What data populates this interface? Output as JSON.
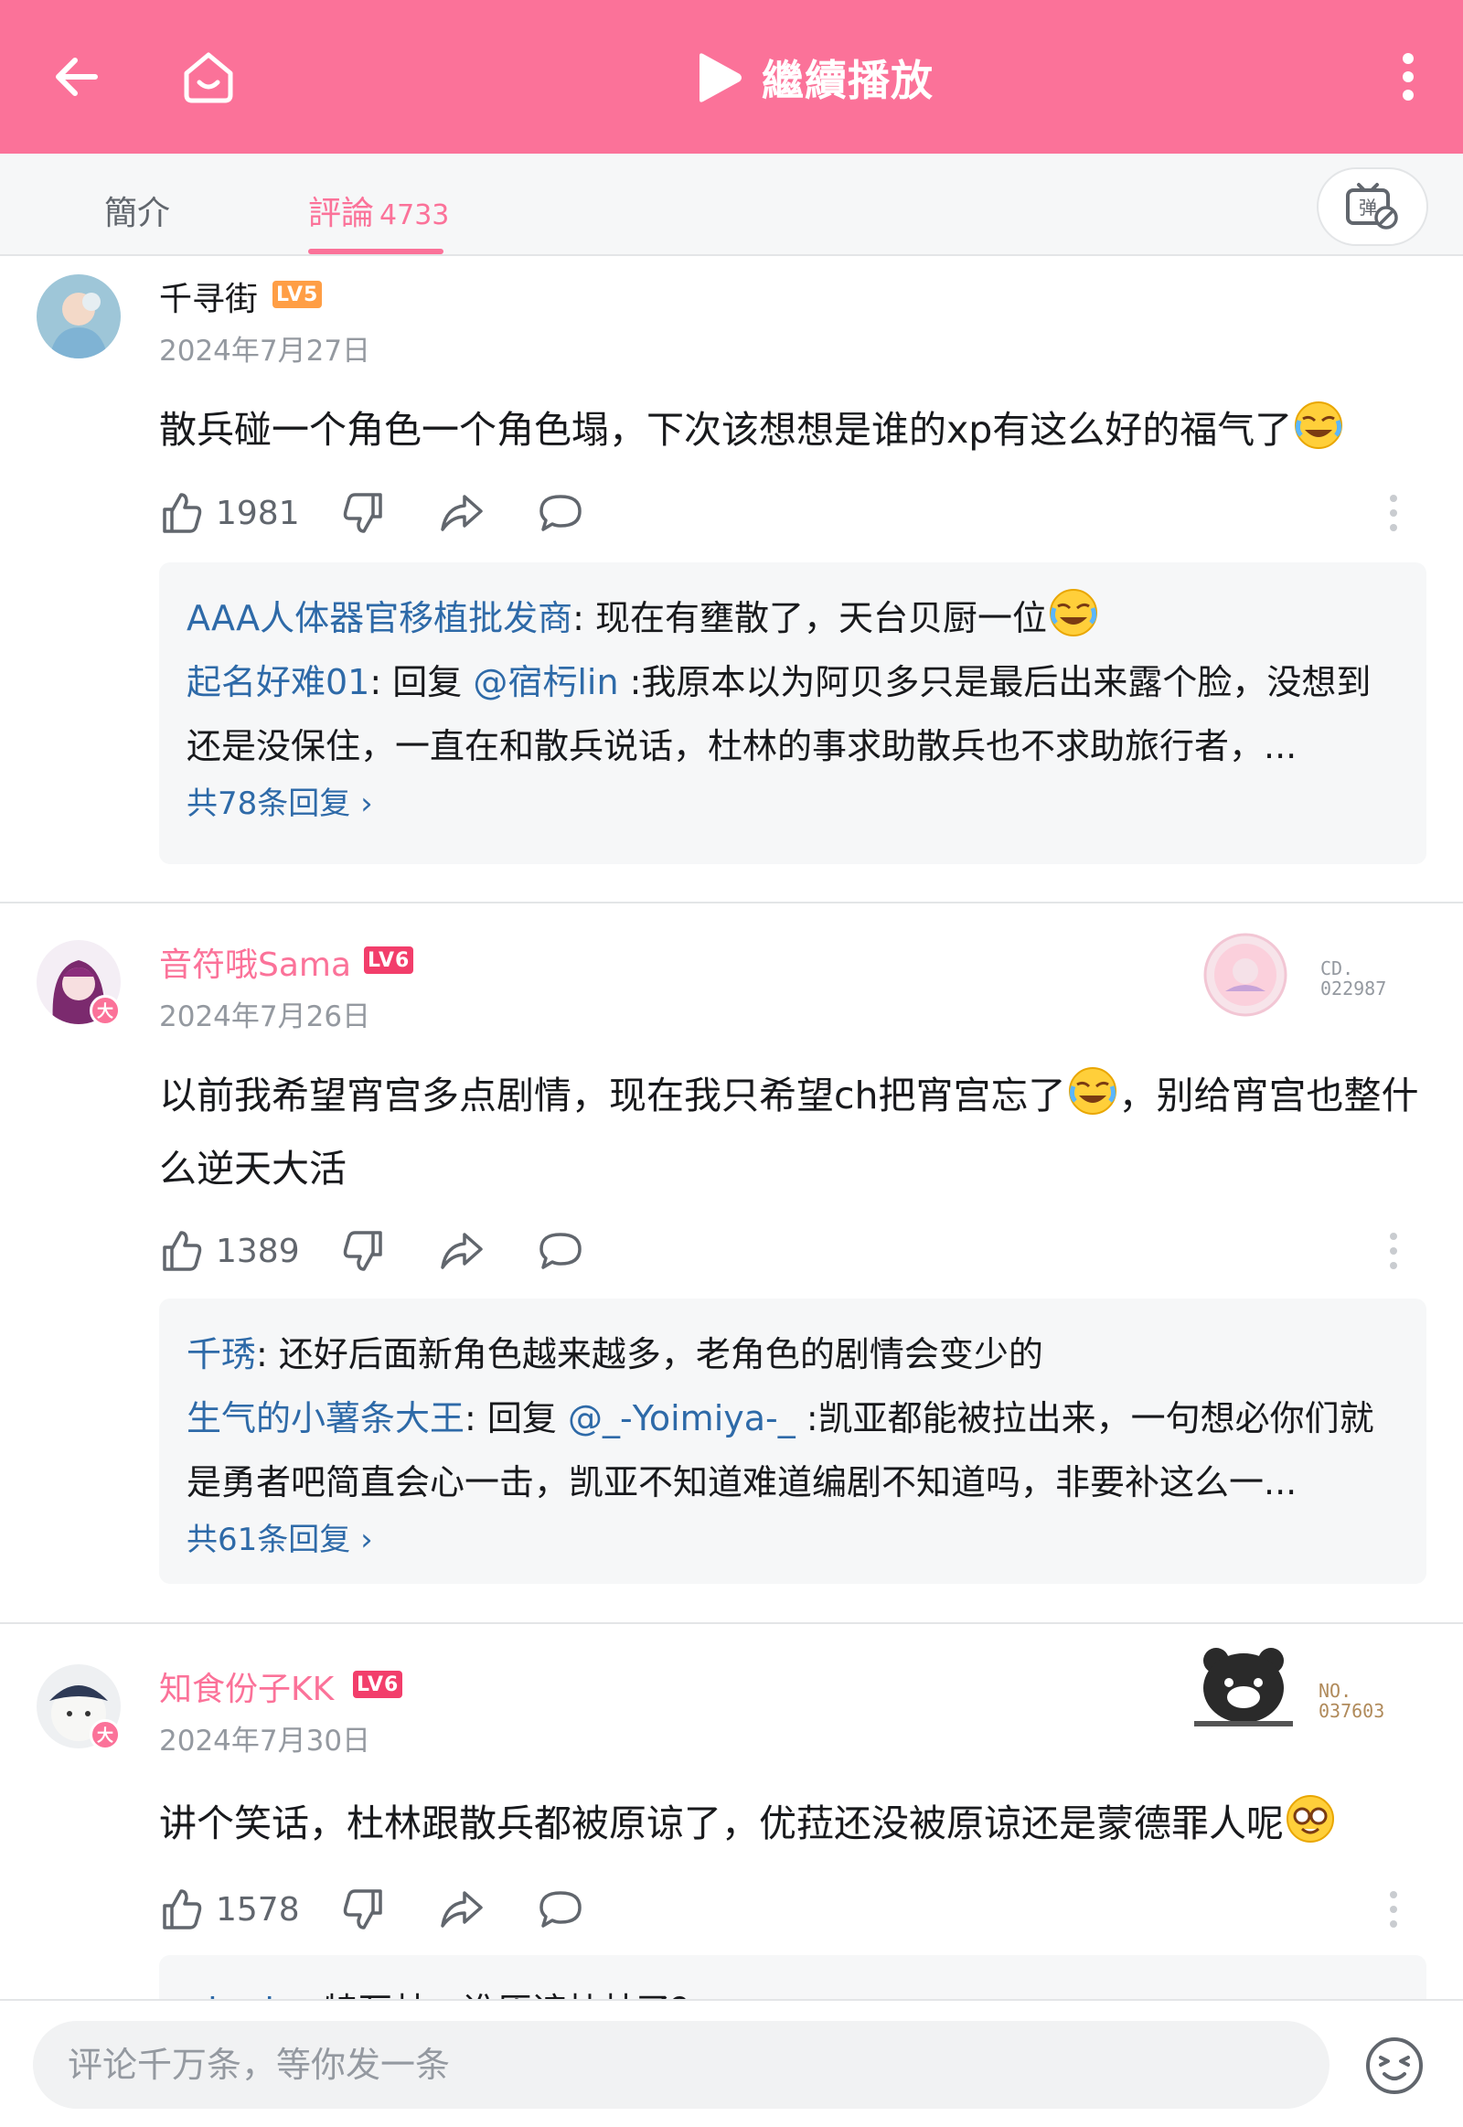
{
  "header": {
    "continue_play_label": "繼續播放",
    "background_color": "#fb7299",
    "icons": [
      "back-arrow-icon",
      "home-tv-icon",
      "play-icon",
      "more-vertical-icon"
    ]
  },
  "tabs": {
    "intro_label": "簡介",
    "comments_label": "評論",
    "comments_count": "4733",
    "danmaku_icon": "danmaku-off-icon"
  },
  "comments": [
    {
      "username": "千寻街",
      "level": "LV5",
      "date": "2024年7月27日",
      "text": "散兵碰一个角色一个角色塌，下次该想想是谁的xp有这么好的福气了",
      "likes": "1981",
      "replies": [
        {
          "name": "AAA人体器官移植批发商",
          "sep": ": ",
          "content": "现在有壅散了，天台贝厨一位"
        },
        {
          "name": "起名好难01",
          "sep": ": ",
          "reply_prefix": "回复 ",
          "at": "@宿杇lin",
          "content": " :我原本以为阿贝多只是最后出来露个脸，没想到还是没保住，一直在和散兵说话，杜林的事求助散兵也不求助旅行者，..."
        }
      ],
      "more_replies": "共78条回复 ›"
    },
    {
      "username": "音符哦Sama",
      "level": "LV6",
      "date": "2024年7月26日",
      "text_part1": "以前我希望宵宫多点剧情，现在我只希望ch把宵宫忘了",
      "text_part2": "，别给宵宫也整什么逆天大活",
      "likes": "1389",
      "fan_badge_no": "CD.\n022987",
      "replies": [
        {
          "name": "千琇",
          "sep": ": ",
          "content": "还好后面新角色越来越多，老角色的剧情会变少的"
        },
        {
          "name": "生气的小薯条大王",
          "sep": ": ",
          "reply_prefix": "回复 ",
          "at": "@_-Yoimiya-_",
          "content": " :凯亚都能被拉出来，一句想必你们就是勇者吧简直会心一击，凯亚不知道难道编剧不知道吗，非要补这么一..."
        }
      ],
      "more_replies": "共61条回复 ›"
    },
    {
      "username": "知食份子KK",
      "level": "LV6",
      "date": "2024年7月30日",
      "text": "讲个笑话，杜林跟散兵都被原谅了，优菈还没被原谅还是蒙德罪人呢",
      "likes": "1578",
      "fan_badge_no": "NO.\n037603",
      "replies": [
        {
          "name": "obrebr",
          "sep": ": ",
          "content": "特瓦林：谁原谅杜林了？"
        }
      ]
    }
  ],
  "vip_badge": "大",
  "bottom": {
    "input_placeholder": "评论千万条，等你发一条",
    "emoji_icon": "emoji-face-icon"
  }
}
